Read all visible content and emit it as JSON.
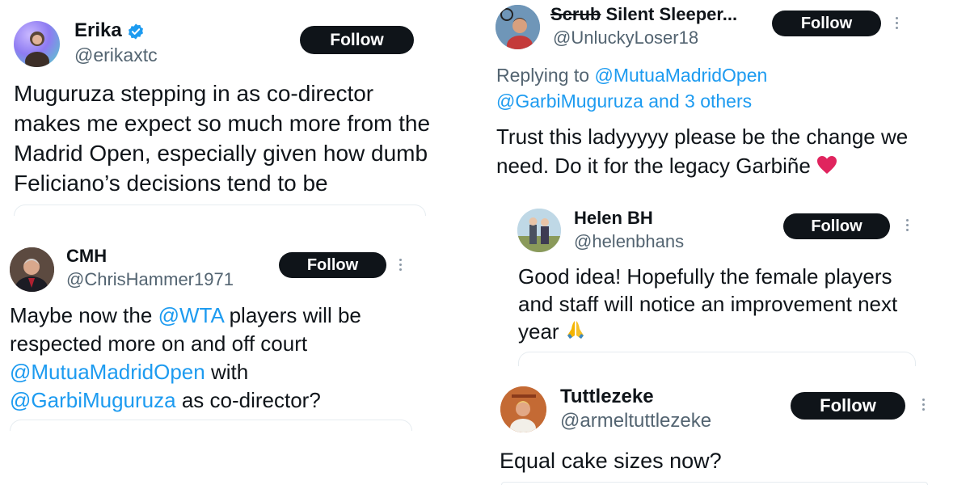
{
  "tweets": {
    "erika": {
      "name": "Erika",
      "handle": "@erikaxtc",
      "follow": "Follow",
      "text": "Muguruza stepping in as co-director makes me expect so much more from the Madrid Open, especially given how dumb Feliciano’s decisions tend to be"
    },
    "cmh": {
      "name": "CMH",
      "handle": "@ChrisHammer1971",
      "follow": "Follow",
      "text_1": "Maybe now the ",
      "mention_1": "@WTA",
      "text_2": " players will be respected more on and off court ",
      "mention_2": "@MutuaMadridOpen",
      "text_3": " with ",
      "mention_3": "@GarbiMuguruza",
      "text_4": " as co-director?"
    },
    "scrub": {
      "name_struck": "Scrub",
      "name_rest": " Silent Sleeper...",
      "handle": "@UnluckyLoser18",
      "follow": "Follow",
      "replying_prefix": "Replying to ",
      "replying_mention": "@MutuaMadridOpen",
      "replying_line2": "@GarbiMuguruza and 3 others",
      "text": "Trust this ladyyyyy please be the change we need. Do it for the legacy Garbiñe"
    },
    "helen": {
      "name": "Helen BH",
      "handle": "@helenbhans",
      "follow": "Follow",
      "text": "Good idea!  Hopefully the female players and staff will notice an improvement next year"
    },
    "tuttle": {
      "name": "Tuttlezeke",
      "handle": "@armeltuttlezeke",
      "follow": "Follow",
      "text": "Equal cake sizes now?"
    }
  },
  "colors": {
    "link": "#1d9bf0",
    "follow_bg": "#0f1419",
    "secondary": "#536471",
    "verified": "#1d9bf0",
    "heart": "#e0245e"
  },
  "icons": [
    "verified-badge-icon",
    "more-options-icon",
    "red-heart-emoji",
    "folded-hands-emoji"
  ]
}
